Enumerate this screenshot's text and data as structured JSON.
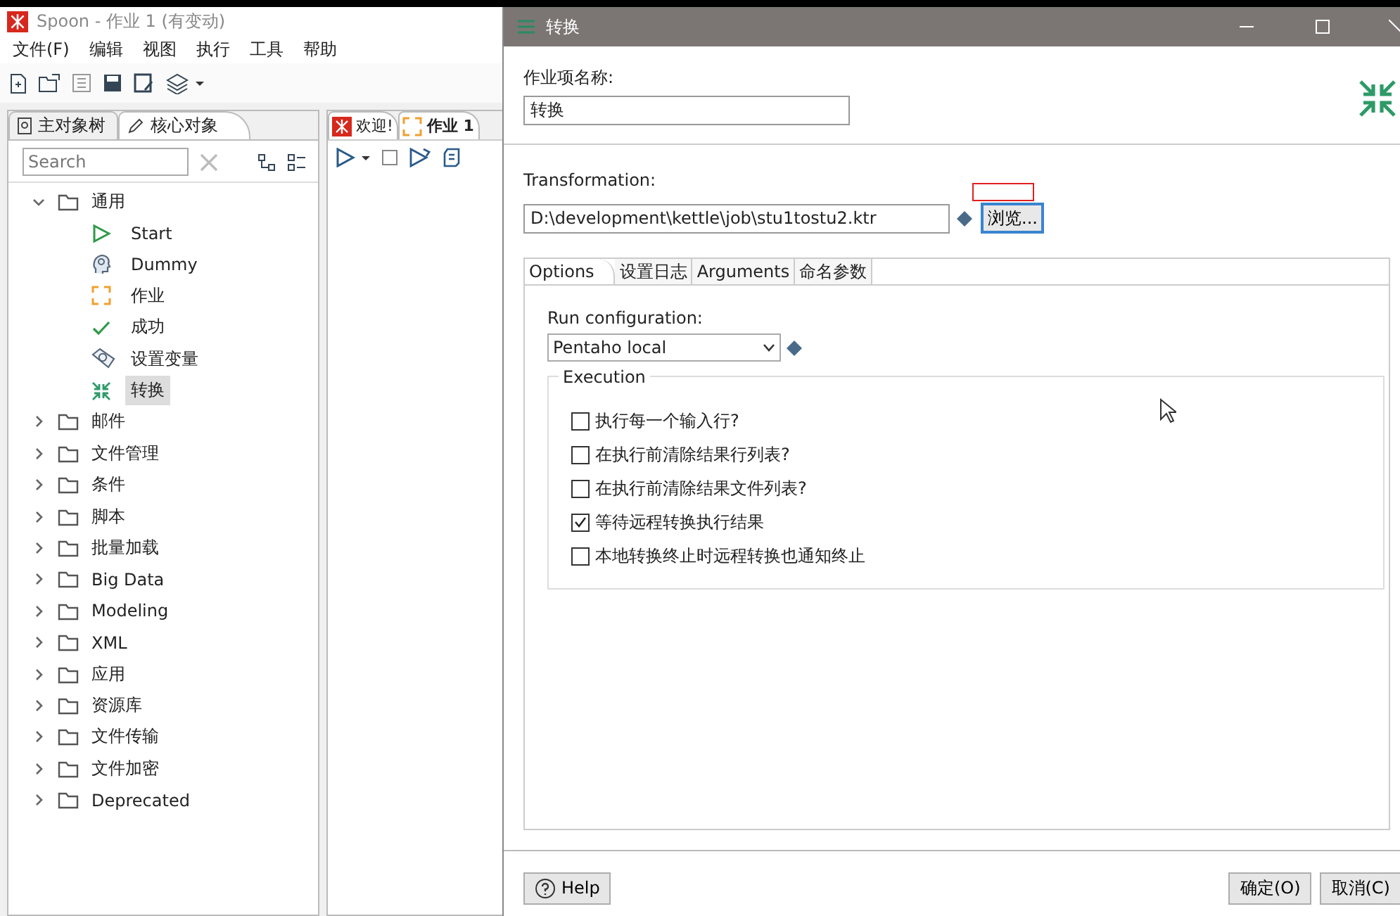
{
  "spoon": {
    "title": "Spoon - 作业 1 (有变动)",
    "menu": [
      "文件(F)",
      "编辑",
      "视图",
      "执行",
      "工具",
      "帮助"
    ],
    "panel_tabs": [
      {
        "label": "主对象树",
        "kind": "tree",
        "selected": false
      },
      {
        "label": "核心对象",
        "kind": "pencil",
        "selected": true
      }
    ],
    "search": {
      "placeholder": "Search"
    },
    "tree": [
      {
        "label": "通用",
        "expanded": true,
        "selected": false,
        "children": [
          {
            "label": "Start",
            "kind": "start",
            "selected": false
          },
          {
            "label": "Dummy",
            "kind": "dummy",
            "selected": false
          },
          {
            "label": "作业",
            "kind": "job",
            "selected": false
          },
          {
            "label": "成功",
            "kind": "success",
            "selected": false
          },
          {
            "label": "设置变量",
            "kind": "variable",
            "selected": false
          },
          {
            "label": "转换",
            "kind": "transformation",
            "selected": true
          }
        ]
      },
      {
        "label": "邮件",
        "expanded": false,
        "selected": false
      },
      {
        "label": "文件管理",
        "expanded": false,
        "selected": false
      },
      {
        "label": "条件",
        "expanded": false,
        "selected": false
      },
      {
        "label": "脚本",
        "expanded": false,
        "selected": false
      },
      {
        "label": "批量加载",
        "expanded": false,
        "selected": false
      },
      {
        "label": "Big Data",
        "expanded": false,
        "selected": false
      },
      {
        "label": "Modeling",
        "expanded": false,
        "selected": false
      },
      {
        "label": "XML",
        "expanded": false,
        "selected": false
      },
      {
        "label": "应用",
        "expanded": false,
        "selected": false
      },
      {
        "label": "资源库",
        "expanded": false,
        "selected": false
      },
      {
        "label": "文件传输",
        "expanded": false,
        "selected": false
      },
      {
        "label": "文件加密",
        "expanded": false,
        "selected": false
      },
      {
        "label": "Deprecated",
        "expanded": false,
        "selected": false
      }
    ],
    "editor_tabs": [
      {
        "label": "欢迎!",
        "kind": "welcome",
        "selected": false
      },
      {
        "label": "作业 1",
        "kind": "job",
        "selected": true
      }
    ]
  },
  "dialog": {
    "title": "转换",
    "name_label": "作业项名称:",
    "name_value": "转换",
    "transformation_label": "Transformation:",
    "transformation_value": "D:\\development\\kettle\\job\\stu1tostu2.ktr",
    "browse_button": "浏览...",
    "tabs": [
      {
        "label": "Options",
        "selected": true
      },
      {
        "label": "设置日志",
        "selected": false
      },
      {
        "label": "Arguments",
        "selected": false
      },
      {
        "label": "命名参数",
        "selected": false
      }
    ],
    "run_config_label": "Run configuration:",
    "run_config_value": "Pentaho local",
    "execution_title": "Execution",
    "options": [
      {
        "label": "执行每一个输入行?",
        "checked": false
      },
      {
        "label": "在执行前清除结果行列表?",
        "checked": false
      },
      {
        "label": "在执行前清除结果文件列表?",
        "checked": false
      },
      {
        "label": "等待远程转换执行结果",
        "checked": true
      },
      {
        "label": "本地转换终止时远程转换也通知终止",
        "checked": false
      }
    ],
    "help_button": "Help",
    "ok_button": "确定(O)",
    "cancel_button": "取消(C)"
  }
}
